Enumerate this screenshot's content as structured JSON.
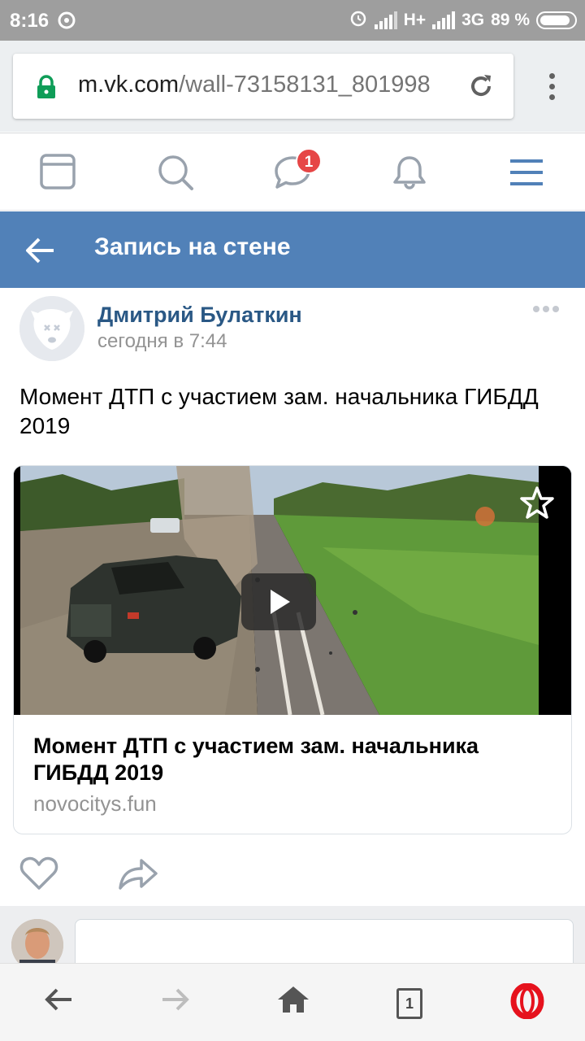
{
  "status_bar": {
    "time": "8:16",
    "network_1": "H+",
    "network_2": "3G",
    "battery": "89 %",
    "battery_level": 0.89
  },
  "browser": {
    "url_host": "m.vk.com",
    "url_path": "/wall-73158131_801998"
  },
  "vk_nav": {
    "messages_badge": "1",
    "items": [
      "feed-icon",
      "search-icon",
      "messages-icon",
      "notifications-icon",
      "menu-icon"
    ]
  },
  "header": {
    "title": "Запись на стене"
  },
  "post": {
    "author": "Дмитрий Булаткин",
    "time": "сегодня в 7:44",
    "text": "Момент ДТП с участием зам. начальника ГИБДД 2019"
  },
  "link_card": {
    "title": "Момент ДТП с участием зам. начальника ГИБДД 2019",
    "domain": "novocitys.fun"
  },
  "bottom_bar": {
    "tab_count": "1"
  },
  "colors": {
    "vk_blue": "#5181b8",
    "link_blue": "#2a5885",
    "badge_red": "#e64646",
    "opera_red": "#e6121d",
    "lock_green": "#0f9d58"
  }
}
